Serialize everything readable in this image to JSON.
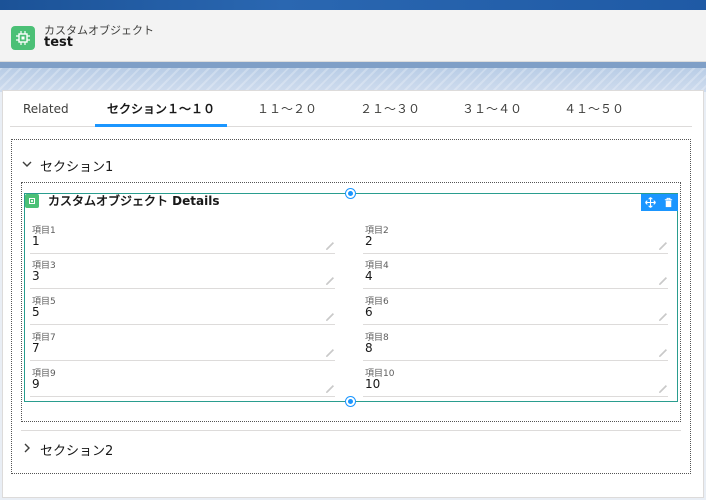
{
  "header": {
    "object_type": "カスタムオブジェクト",
    "record_name": "test",
    "icon": "custom-object-icon"
  },
  "tabs": [
    {
      "label": "Related",
      "active": false
    },
    {
      "label": "セクション１～１０",
      "active": true
    },
    {
      "label": "１１～２０",
      "active": false
    },
    {
      "label": "２１～３０",
      "active": false
    },
    {
      "label": "３１～４０",
      "active": false
    },
    {
      "label": "４１～５０",
      "active": false
    }
  ],
  "sections": [
    {
      "label": "セクション1",
      "expanded": true,
      "icon": "chevron-down-icon"
    },
    {
      "label": "セクション2",
      "expanded": false,
      "icon": "chevron-right-icon"
    }
  ],
  "details": {
    "title": "カスタムオブジェクト Details",
    "toolbar": [
      "move-icon",
      "delete-icon"
    ],
    "fields": [
      {
        "label": "項目1",
        "value": "1"
      },
      {
        "label": "項目2",
        "value": "2"
      },
      {
        "label": "項目3",
        "value": "3"
      },
      {
        "label": "項目4",
        "value": "4"
      },
      {
        "label": "項目5",
        "value": "5"
      },
      {
        "label": "項目6",
        "value": "6"
      },
      {
        "label": "項目7",
        "value": "7"
      },
      {
        "label": "項目8",
        "value": "8"
      },
      {
        "label": "項目9",
        "value": "9"
      },
      {
        "label": "項目10",
        "value": "10"
      }
    ]
  },
  "colors": {
    "accent": "#1b96ff",
    "icon_green": "#4bc076",
    "component_border": "#2a9d8f"
  }
}
